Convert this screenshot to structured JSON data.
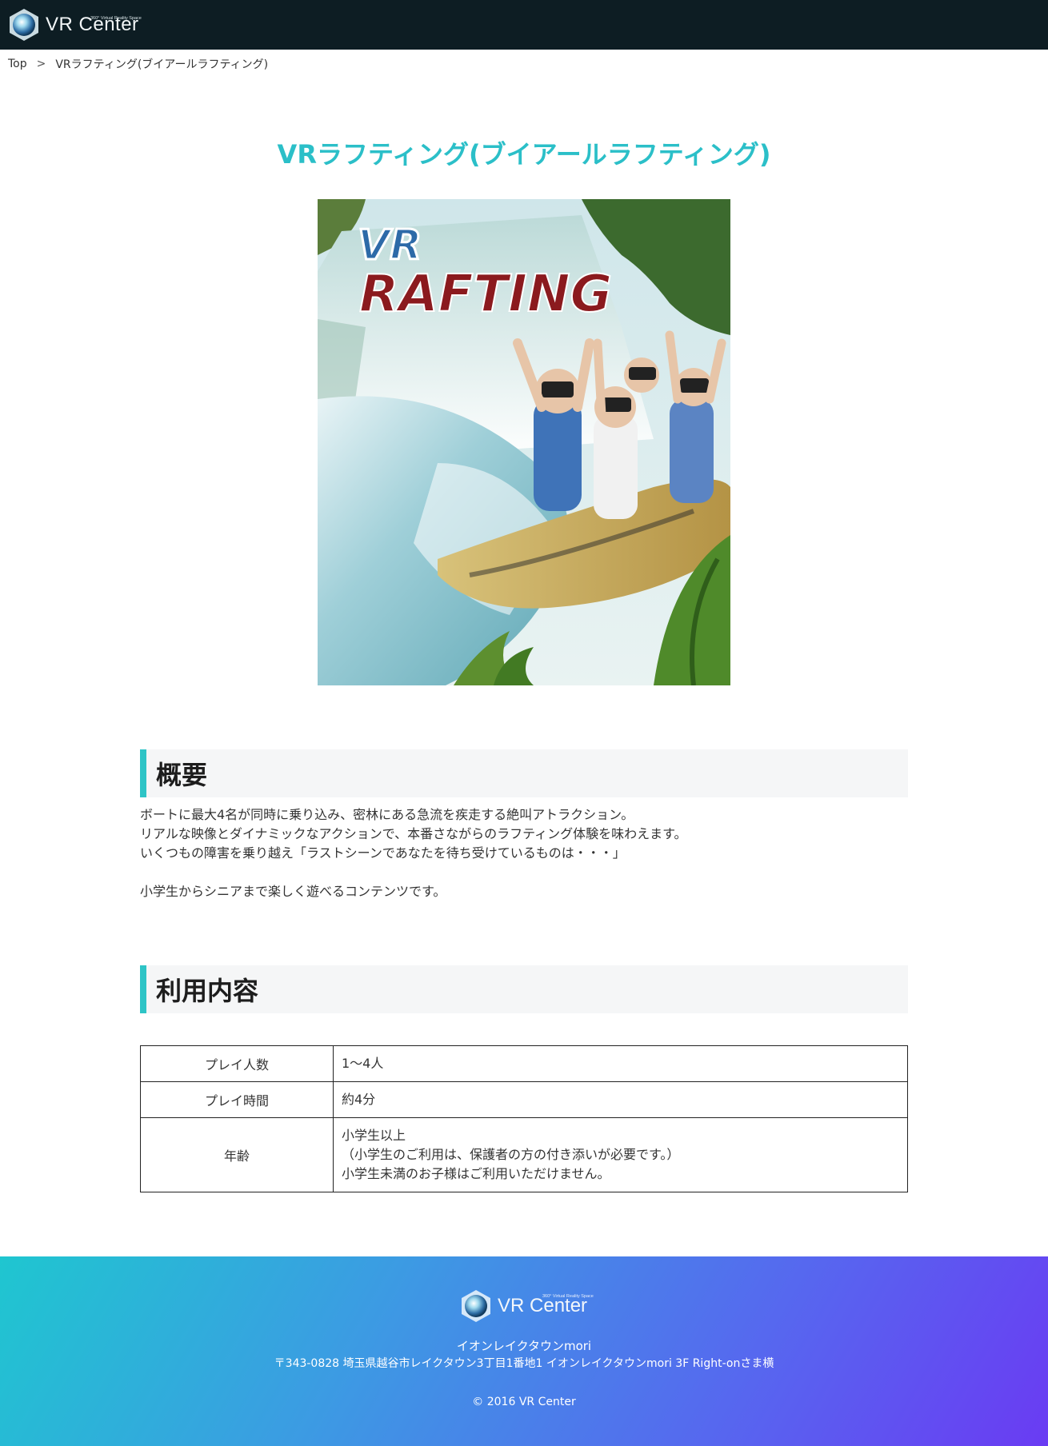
{
  "header": {
    "brand": "VR Center",
    "tagline": "360° Virtual Reality Space",
    "logo_icon": "vr-orb-icon"
  },
  "breadcrumb": {
    "home": "Top",
    "separator": ">",
    "current": "VRラフティング(ブイアールラフティング)"
  },
  "page": {
    "title": "VRラフティング(ブイアールラフティング)",
    "hero_logo_small": "VR",
    "hero_logo_big": "RAFTING"
  },
  "overview": {
    "heading": "概要",
    "lines": [
      "ボートに最大4名が同時に乗り込み、密林にある急流を疾走する絶叫アトラクション。",
      "リアルな映像とダイナミックなアクションで、本番さながらのラフティング体験を味わえます。",
      "いくつもの障害を乗り越え「ラストシーンであなたを待ち受けているものは・・・」",
      "",
      "小学生からシニアまで楽しく遊べるコンテンツです。"
    ]
  },
  "usage": {
    "heading": "利用内容",
    "rows": [
      {
        "label": "プレイ人数",
        "lines": [
          "1〜4人"
        ]
      },
      {
        "label": "プレイ時間",
        "lines": [
          "約4分"
        ]
      },
      {
        "label": "年齢",
        "lines": [
          "小学生以上",
          "（小学生のご利用は、保護者の方の付き添いが必要です。）",
          "小学生未満のお子様はご利用いただけません。"
        ]
      }
    ]
  },
  "footer": {
    "brand": "VR Center",
    "tagline": "360° Virtual Reality Space",
    "store_name": "イオンレイクタウンmori",
    "address": "〒343-0828 埼玉県越谷市レイクタウン3丁目1番地1 イオンレイクタウンmori 3F Right-onさま横",
    "copyright": "© 2016 VR Center"
  },
  "colors": {
    "accent": "#2bbfc8",
    "header_bg": "#0d1d23",
    "footer_gradient_start": "#1fc6d0",
    "footer_gradient_end": "#6a3bf3"
  }
}
